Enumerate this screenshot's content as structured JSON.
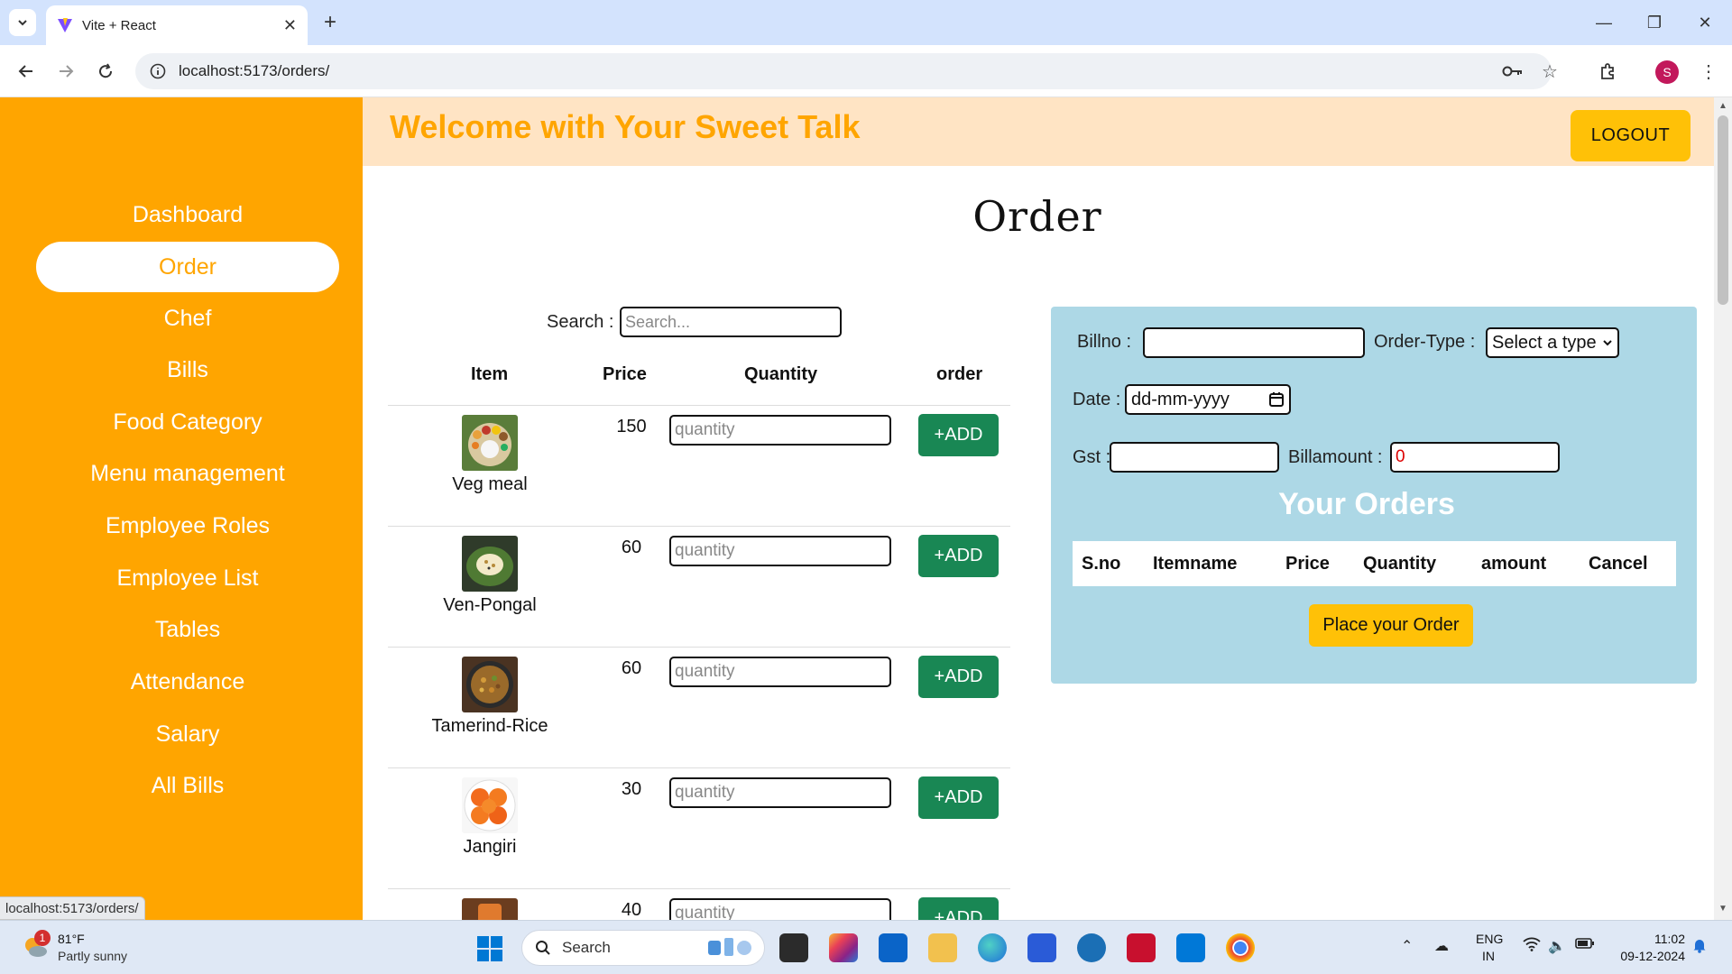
{
  "browser": {
    "tab_title": "Vite + React",
    "url": "localhost:5173/orders/",
    "profile_initial": "S",
    "status_url": "localhost:5173/orders/"
  },
  "sidebar": {
    "items": [
      {
        "label": "Dashboard",
        "active": false
      },
      {
        "label": "Order",
        "active": true
      },
      {
        "label": "Chef",
        "active": false
      },
      {
        "label": "Bills",
        "active": false
      },
      {
        "label": "Food Category",
        "active": false
      },
      {
        "label": "Menu management",
        "active": false
      },
      {
        "label": "Employee Roles",
        "active": false
      },
      {
        "label": "Employee List",
        "active": false
      },
      {
        "label": "Tables",
        "active": false
      },
      {
        "label": "Attendance",
        "active": false
      },
      {
        "label": "Salary",
        "active": false
      },
      {
        "label": "All Bills",
        "active": false
      }
    ]
  },
  "header": {
    "welcome": "Welcome with Your Sweet Talk",
    "logout_label": "LOGOUT"
  },
  "main": {
    "title": "Order",
    "search_label": "Search :",
    "search_placeholder": "Search...",
    "columns": [
      "Item",
      "Price",
      "Quantity",
      "order"
    ],
    "quantity_placeholder": "quantity",
    "add_label": "+ADD",
    "items": [
      {
        "name": "Veg meal",
        "price": "150"
      },
      {
        "name": "Ven-Pongal",
        "price": "60"
      },
      {
        "name": "Tamerind-Rice",
        "price": "60"
      },
      {
        "name": "Jangiri",
        "price": "30"
      },
      {
        "name": "",
        "price": "40"
      }
    ]
  },
  "order_form": {
    "billno_label": "Billno :",
    "billno_value": "",
    "order_type_label": "Order-Type :",
    "order_type_value": "Select a type",
    "date_label": "Date :",
    "date_placeholder": "dd-mm-yyyy",
    "gst_label": "Gst :",
    "gst_value": "",
    "billamount_label": "Billamount :",
    "billamount_value": "0",
    "your_orders_title": "Your Orders",
    "columns": [
      "S.no",
      "Itemname",
      "Price",
      "Quantity",
      "amount",
      "Cancel"
    ],
    "place_order_label": "Place your Order"
  },
  "taskbar": {
    "weather_temp": "81°F",
    "weather_desc": "Partly sunny",
    "weather_badge": "1",
    "search_label": "Search",
    "lang_line1": "ENG",
    "lang_line2": "IN",
    "time": "11:02",
    "date": "09-12-2024"
  },
  "colors": {
    "sidebar": "#ffa500",
    "header_bg": "#ffe4c4",
    "logout": "#ffc107",
    "add_button": "#198754",
    "order_panel": "#add8e6"
  }
}
